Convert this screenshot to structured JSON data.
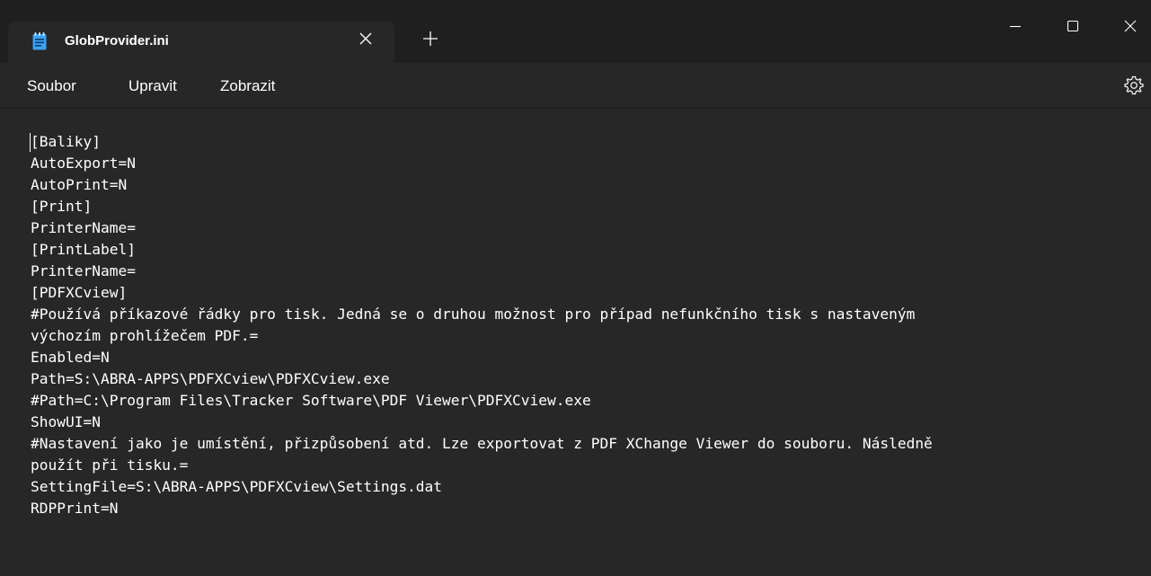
{
  "window": {
    "tab_title": "GlobProvider.ini",
    "tab_icon": "notepad-icon",
    "close_tab_icon": "close-icon",
    "new_tab_icon": "plus-icon",
    "minimize_icon": "minimize-icon",
    "maximize_icon": "maximize-icon",
    "close_window_icon": "close-icon"
  },
  "menu": {
    "items": [
      "Soubor",
      "Upravit",
      "Zobrazit"
    ],
    "settings_icon": "gear-icon"
  },
  "editor": {
    "lines": [
      "[Baliky]",
      "AutoExport=N",
      "AutoPrint=N",
      "[Print]",
      "PrinterName=",
      "[PrintLabel]",
      "PrinterName=",
      "[PDFXCview]",
      "#Používá příkazové řádky pro tisk. Jedná se o druhou možnost pro případ nefunkčního tisk s nastaveným",
      "výchozím prohlížečem PDF.=",
      "Enabled=N",
      "Path=S:\\ABRA-APPS\\PDFXCview\\PDFXCview.exe",
      "#Path=C:\\Program Files\\Tracker Software\\PDF Viewer\\PDFXCview.exe",
      "ShowUI=N",
      "#Nastavení jako je umístění, přizpůsobení atd. Lze exportovat z PDF XChange Viewer do souboru. Následně",
      "použít při tisku.=",
      "SettingFile=S:\\ABRA-APPS\\PDFXCview\\Settings.dat",
      "RDPPrint=N"
    ]
  },
  "colors": {
    "titlebar_bg": "#1f1f1f",
    "editor_bg": "#272727",
    "text": "#ffffff",
    "notepad_icon": "#3ba1f2"
  }
}
